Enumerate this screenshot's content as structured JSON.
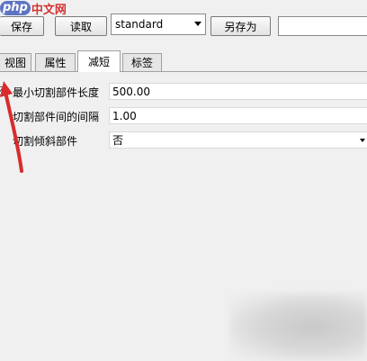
{
  "watermark": {
    "logo": "php",
    "site": "中文网"
  },
  "toolbar": {
    "save_label": "保存",
    "read_label": "读取",
    "profile_value": "standard",
    "saveas_label": "另存为",
    "name_value": ""
  },
  "tabs": [
    {
      "label": "视图"
    },
    {
      "label": "属性"
    },
    {
      "label": "减短",
      "active": true
    },
    {
      "label": "标签"
    }
  ],
  "settings": [
    {
      "label": "最小切割部件长度",
      "value": "500.00",
      "checked": true
    },
    {
      "label": "切割部件间的间隔",
      "value": "1.00"
    },
    {
      "label": "切割倾斜部件",
      "value": "否",
      "type": "dropdown"
    }
  ],
  "colors": {
    "annotation_arrow": "#d92b2b",
    "active_tab": "#ffffff"
  }
}
